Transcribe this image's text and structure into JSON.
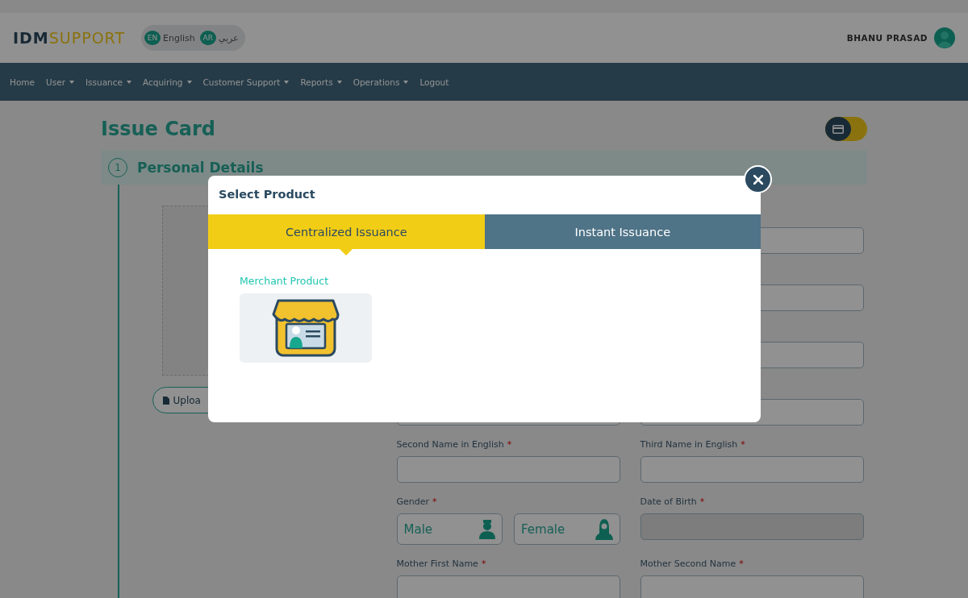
{
  "header": {
    "logo": {
      "strong": "IDM",
      "light": "SUPPORT"
    },
    "languages": [
      {
        "code": "EN",
        "label": "English"
      },
      {
        "code": "AR",
        "label": "عربي"
      }
    ],
    "user": "BHANU PRASAD"
  },
  "nav": [
    {
      "label": "Home",
      "dropdown": false
    },
    {
      "label": "User",
      "dropdown": true
    },
    {
      "label": "Issuance",
      "dropdown": true
    },
    {
      "label": "Acquiring",
      "dropdown": true
    },
    {
      "label": "Customer Support",
      "dropdown": true
    },
    {
      "label": "Reports",
      "dropdown": true
    },
    {
      "label": "Operations",
      "dropdown": true
    },
    {
      "label": "Logout",
      "dropdown": false
    }
  ],
  "card_toggle": {
    "on": false
  },
  "page": {
    "title": "Issue Card",
    "section": {
      "number": "1",
      "title": "Personal Details"
    },
    "upload": "Uploa",
    "rows": [
      {
        "cells": [
          {
            "kind": "covered"
          },
          {
            "kind": "input"
          }
        ]
      },
      {
        "cells": [
          {
            "kind": "covered"
          },
          {
            "kind": "input"
          }
        ]
      },
      {
        "cells": [
          {
            "kind": "covered"
          },
          {
            "kind": "input"
          }
        ]
      },
      {
        "cells": [
          {
            "kind": "input"
          },
          {
            "kind": "input"
          }
        ]
      },
      {
        "cells": [
          {
            "kind": "input",
            "label": "Second Name in English",
            "marker": "*"
          },
          {
            "kind": "input",
            "label": "Third Name in English",
            "marker": "*"
          }
        ]
      },
      {
        "cells": [
          {
            "kind": "gender",
            "label": "Gender",
            "marker": "*",
            "options": [
              {
                "label": "Male",
                "selected": false
              },
              {
                "label": "Female",
                "selected": false
              }
            ]
          },
          {
            "kind": "input",
            "label": "Date of Birth",
            "marker": "*",
            "disabled": true
          }
        ]
      },
      {
        "cells": [
          {
            "kind": "input",
            "label": "Mother First Name",
            "marker": "*"
          },
          {
            "kind": "input",
            "label": "Mother Second Name",
            "marker": "*"
          }
        ]
      }
    ]
  },
  "modal": {
    "title": "Select Product",
    "tabs": [
      {
        "label": "Centralized Issuance",
        "selected": true
      },
      {
        "label": "Instant Issuance",
        "selected": false
      }
    ],
    "products": [
      {
        "label": "Merchant Product"
      }
    ]
  }
}
